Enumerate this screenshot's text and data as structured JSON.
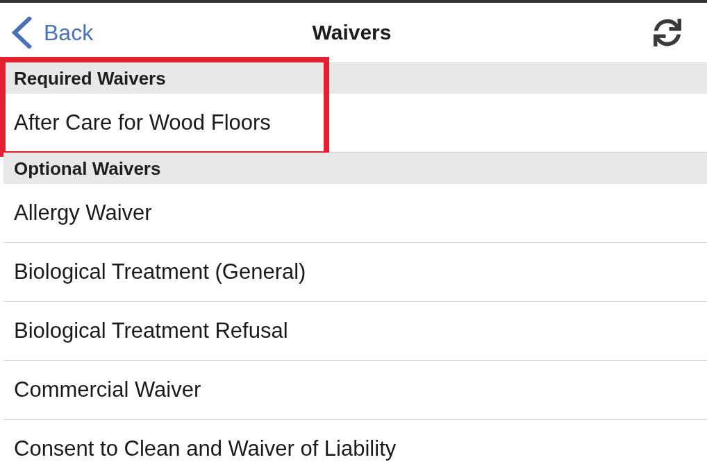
{
  "nav_bar": {
    "back_label": "Back",
    "title": "Waivers"
  },
  "sections": [
    {
      "header": "Required Waivers",
      "highlighted": true,
      "items": [
        {
          "label": "After Care for Wood Floors"
        }
      ]
    },
    {
      "header": "Optional Waivers",
      "highlighted": false,
      "items": [
        {
          "label": "Allergy Waiver"
        },
        {
          "label": "Biological Treatment (General)"
        },
        {
          "label": "Biological Treatment Refusal"
        },
        {
          "label": "Commercial Waiver"
        },
        {
          "label": "Consent to Clean and Waiver of Liability"
        }
      ]
    }
  ]
}
